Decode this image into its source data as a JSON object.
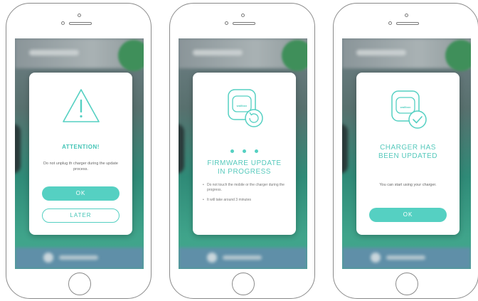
{
  "screens": [
    {
      "title": "ATTENTION!",
      "body": "Do not unplug th charger during the update process.",
      "buttons": {
        "primary": "OK",
        "secondary": "LATER"
      },
      "icon": "warning-triangle-icon"
    },
    {
      "title_line1": "FIRMWARE UPDATE",
      "title_line2": "IN PROGRESS",
      "bullets": [
        "Do not touch the mobile or the charger during the progress.",
        "It will take around 3 minutes"
      ],
      "icon": "charger-refresh-icon",
      "charger_brand": "wallbox"
    },
    {
      "title_line1": "CHARGER HAS",
      "title_line2": "BEEN UPDATED",
      "body": "You can start using your charger.",
      "buttons": {
        "primary": "OK"
      },
      "icon": "charger-check-icon",
      "charger_brand": "wallbox"
    }
  ],
  "colors": {
    "accent": "#55d0c2",
    "accent_text": "#44c4b6"
  }
}
